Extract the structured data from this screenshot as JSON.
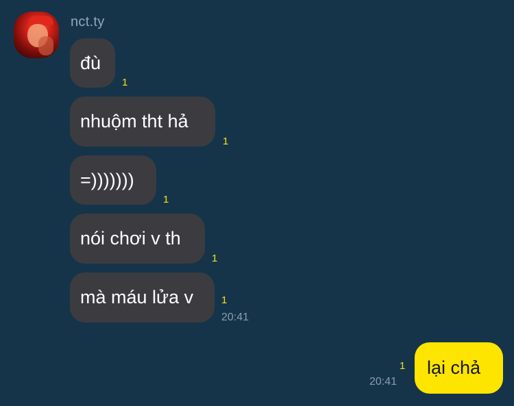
{
  "chat": {
    "sender": {
      "name": "nct.ty",
      "avatar_icon": "profile-photo"
    },
    "incoming_messages": [
      {
        "text": "đù",
        "unread": "1"
      },
      {
        "text": "nhuộm tht hả",
        "unread": "1"
      },
      {
        "text": "=)))))))",
        "unread": "1"
      },
      {
        "text": "nói chơi v th",
        "unread": "1"
      },
      {
        "text": "mà máu lửa v",
        "unread": "1",
        "time": "20:41"
      }
    ],
    "outgoing_messages": [
      {
        "text": "lại chả",
        "unread": "1",
        "time": "20:41"
      }
    ]
  },
  "colors": {
    "background": "#15344a",
    "incoming_bubble": "#3c3c40",
    "outgoing_bubble": "#fee500",
    "unread_count": "#f4e21a"
  }
}
